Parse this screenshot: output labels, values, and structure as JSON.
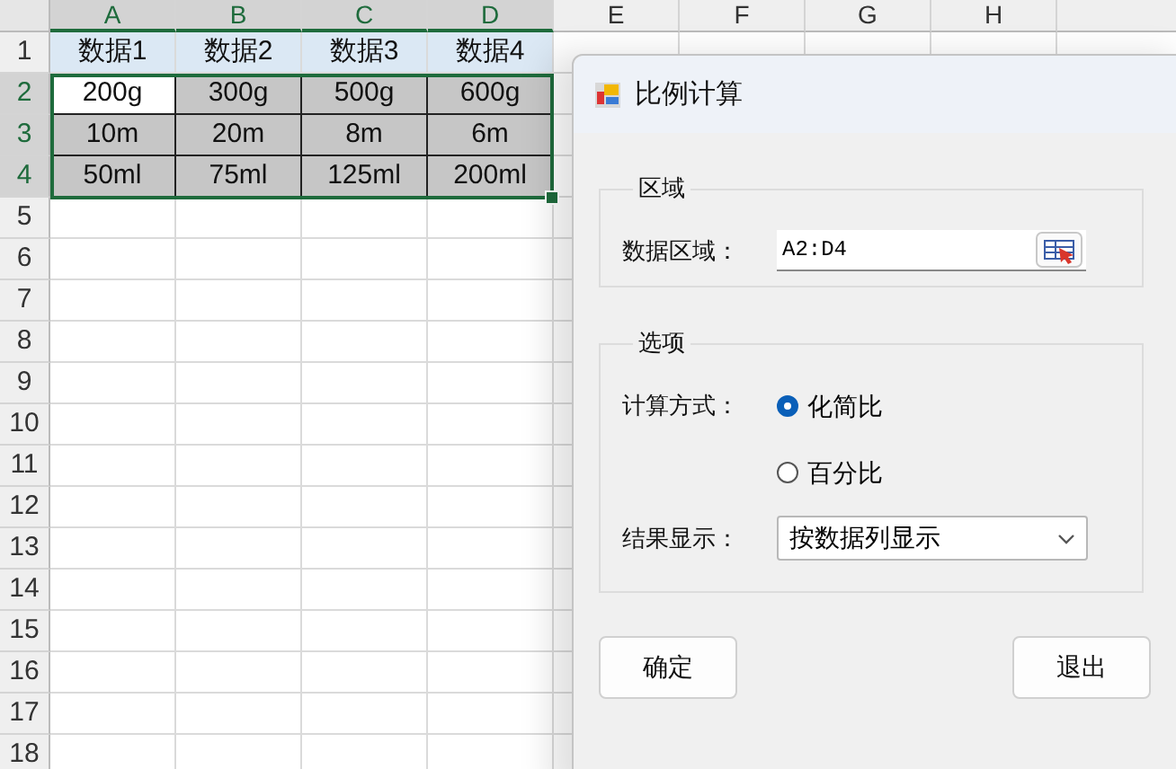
{
  "sheet": {
    "columns": [
      {
        "label": "A",
        "selected": true
      },
      {
        "label": "B",
        "selected": true
      },
      {
        "label": "C",
        "selected": true
      },
      {
        "label": "D",
        "selected": true
      },
      {
        "label": "E",
        "selected": false
      },
      {
        "label": "F",
        "selected": false
      },
      {
        "label": "G",
        "selected": false
      },
      {
        "label": "H",
        "selected": false
      }
    ],
    "rows": [
      {
        "number": "1",
        "selected": false,
        "kind": "heading",
        "cells": [
          {
            "text": "数据1"
          },
          {
            "text": "数据2"
          },
          {
            "text": "数据3"
          },
          {
            "text": "数据4"
          }
        ]
      },
      {
        "number": "2",
        "selected": true,
        "kind": "data",
        "cells": [
          {
            "text": "200g",
            "active": true
          },
          {
            "text": "300g",
            "active": false
          },
          {
            "text": "500g",
            "active": false
          },
          {
            "text": "600g",
            "active": false
          }
        ]
      },
      {
        "number": "3",
        "selected": true,
        "kind": "data",
        "cells": [
          {
            "text": "10m",
            "active": false
          },
          {
            "text": "20m",
            "active": false
          },
          {
            "text": "8m",
            "active": false
          },
          {
            "text": "6m",
            "active": false
          }
        ]
      },
      {
        "number": "4",
        "selected": true,
        "kind": "data",
        "cells": [
          {
            "text": "50ml",
            "active": false
          },
          {
            "text": "75ml",
            "active": false
          },
          {
            "text": "125ml",
            "active": false
          },
          {
            "text": "200ml",
            "active": false
          }
        ]
      },
      {
        "number": "5",
        "selected": false
      },
      {
        "number": "6",
        "selected": false
      },
      {
        "number": "7",
        "selected": false
      },
      {
        "number": "8",
        "selected": false
      },
      {
        "number": "9",
        "selected": false
      },
      {
        "number": "10",
        "selected": false
      },
      {
        "number": "11",
        "selected": false
      },
      {
        "number": "12",
        "selected": false
      },
      {
        "number": "13",
        "selected": false
      },
      {
        "number": "14",
        "selected": false
      },
      {
        "number": "15",
        "selected": false
      },
      {
        "number": "16",
        "selected": false
      },
      {
        "number": "17",
        "selected": false
      },
      {
        "number": "18",
        "selected": false
      }
    ]
  },
  "dialog": {
    "title": "比例计算",
    "range_group": {
      "legend": "区域",
      "label": "数据区域：",
      "value": "A2:D4"
    },
    "options_group": {
      "legend": "选项",
      "method_label": "计算方式：",
      "methods": [
        {
          "label": "化简比",
          "selected": true
        },
        {
          "label": "百分比",
          "selected": false
        }
      ],
      "result_label": "结果显示：",
      "result_value": "按数据列显示"
    },
    "buttons": [
      {
        "label": "确定"
      },
      {
        "label": "退出"
      }
    ]
  }
}
